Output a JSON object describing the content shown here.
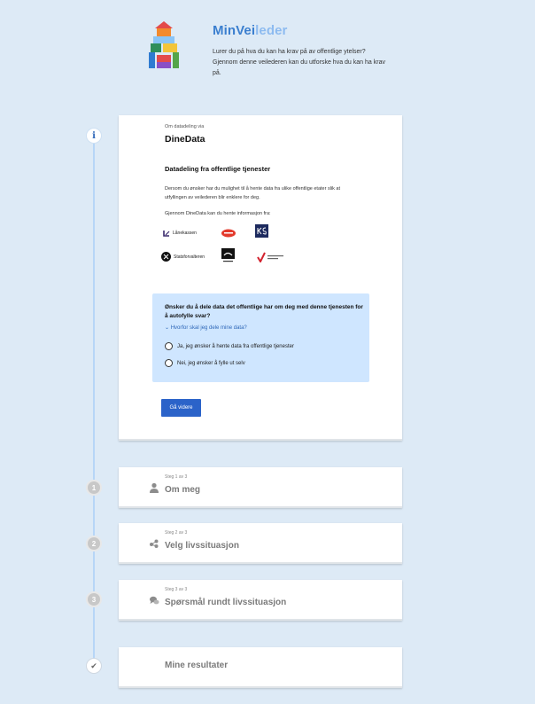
{
  "header": {
    "brand_prefix": "MinVei",
    "brand_suffix": "leder",
    "tagline": "Lurer du på hva du kan ha krav på av offentlige ytelser? Gjennom denne veilederen kan du utforske hva du kan ha krav på."
  },
  "info_step": {
    "marker": "i",
    "eyebrow": "Om datadeling via",
    "title": "DineData",
    "section_heading": "Datadeling fra offentlige tjenester",
    "paragraph1": "Dersom du ønsker har du mulighet til å hente data fra ulike offentlige etater slik at utfyllingen av veilederen blir enklere for deg.",
    "paragraph2": "Gjennom DineData kan du hente informasjon fra:",
    "partners": [
      {
        "name": "Lånekassen",
        "icon": "lanekassen-logo"
      },
      {
        "name": "",
        "icon": "red-logo"
      },
      {
        "name": "",
        "icon": "ks-logo"
      },
      {
        "name": "Statsforvalteren",
        "icon": "statsforvalteren-logo"
      },
      {
        "name": "",
        "icon": "black-logo"
      },
      {
        "name": "",
        "icon": "red-check-logo"
      }
    ],
    "question": "Ønsker du å dele data det offentlige har om deg med denne tjenesten for å autofylle svar?",
    "why_link": "Hvorfor skal jeg dele mine data?",
    "option_yes": "Ja, jeg ønsker å hente data fra offentlige tjenester",
    "option_no": "Nei, jeg ønsker å fylle ut selv",
    "button": "Gå videre"
  },
  "steps": [
    {
      "number": "1",
      "eyebrow": "Steg 1 av 3",
      "title": "Om meg",
      "icon": "person-icon"
    },
    {
      "number": "2",
      "eyebrow": "Steg 2 av 3",
      "title": "Velg livssituasjon",
      "icon": "shuffle-icon"
    },
    {
      "number": "3",
      "eyebrow": "Steg 3 av 3",
      "title": "Spørsmål rundt livssituasjon",
      "icon": "chat-icon"
    }
  ],
  "results": {
    "marker": "✔",
    "title": "Mine resultater"
  },
  "colors": {
    "background": "#ddeaf6",
    "accent": "#2b63c9",
    "question_box": "#cfe6ff",
    "brand_light": "#8dbbf0"
  }
}
